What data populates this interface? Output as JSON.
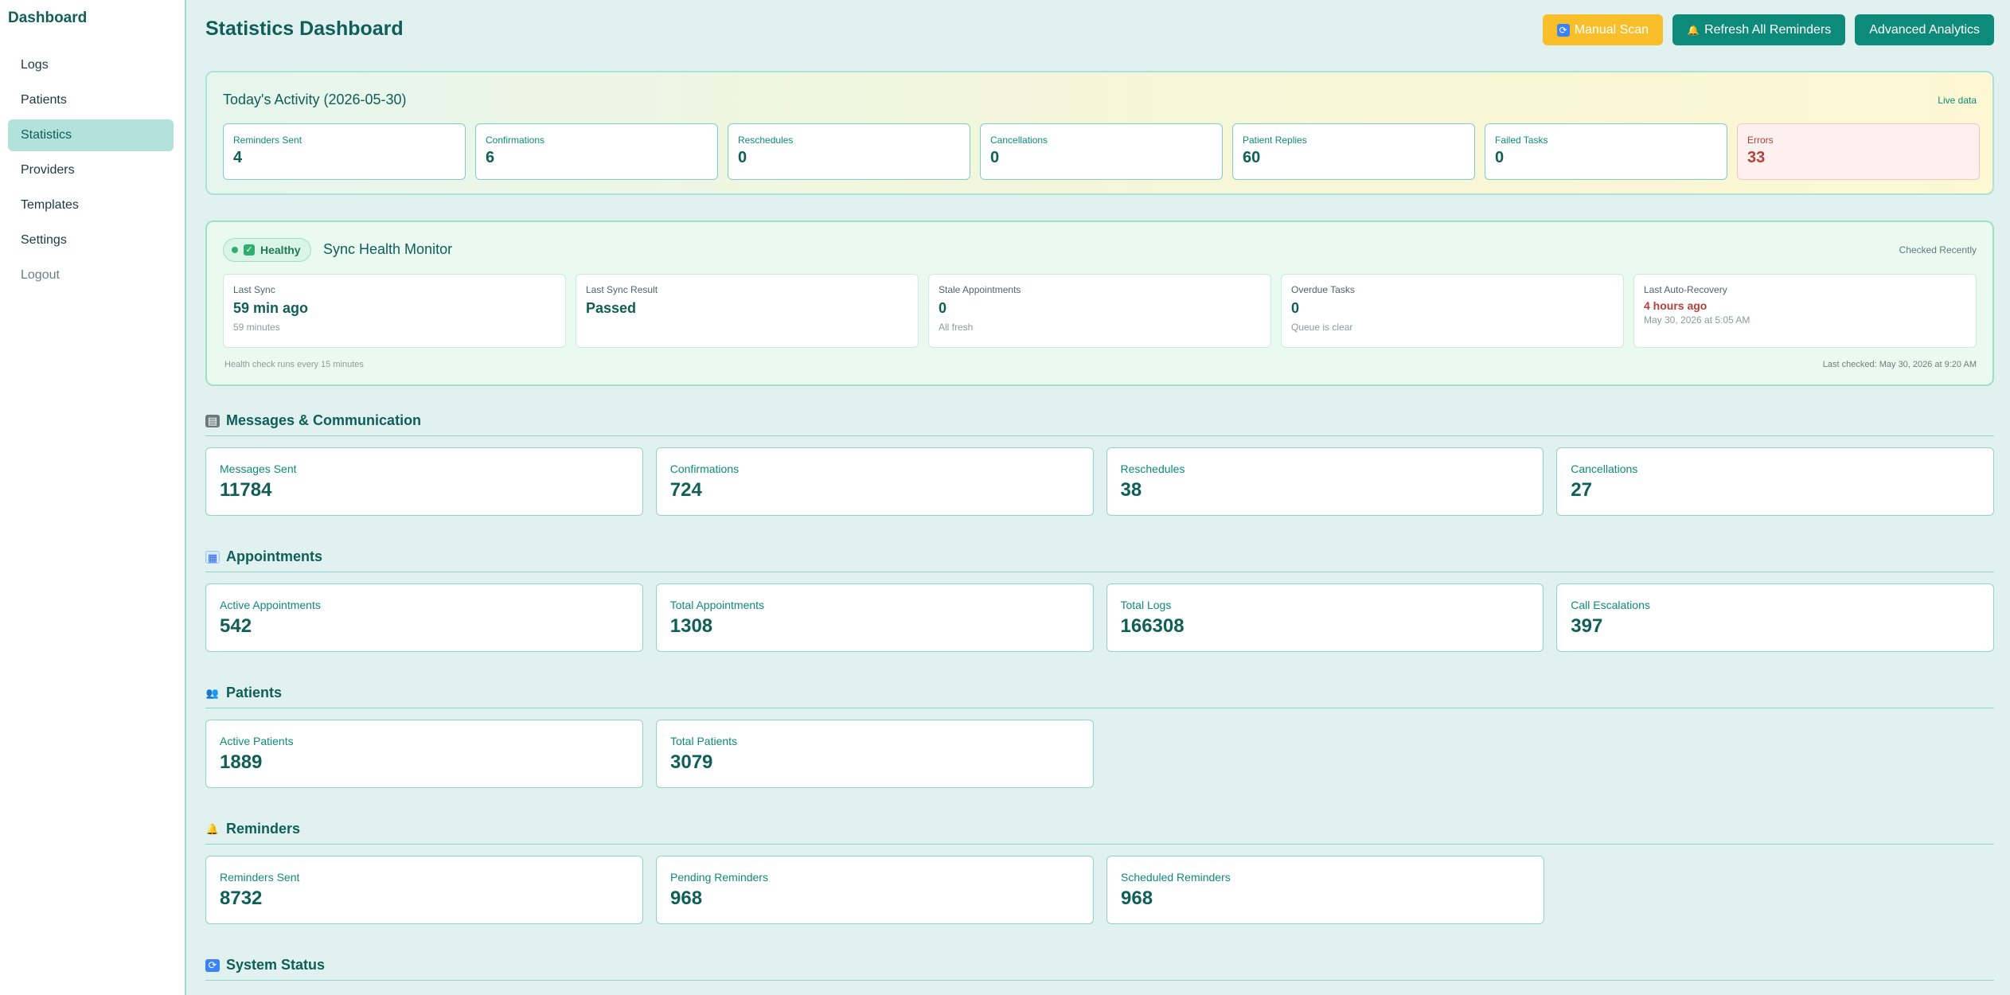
{
  "sidebar": {
    "brand": "Dashboard",
    "items": [
      {
        "label": "Logs"
      },
      {
        "label": "Patients"
      },
      {
        "label": "Statistics"
      },
      {
        "label": "Providers"
      },
      {
        "label": "Templates"
      },
      {
        "label": "Settings"
      },
      {
        "label": "Logout"
      }
    ]
  },
  "header": {
    "title": "Statistics Dashboard",
    "buttons": {
      "manual_scan": "Manual Scan",
      "refresh": "Refresh All Reminders",
      "analytics": "Advanced Analytics"
    }
  },
  "today": {
    "title": "Today's Activity (2026-05-30)",
    "live": "Live data",
    "cards": [
      {
        "label": "Reminders Sent",
        "value": "4"
      },
      {
        "label": "Confirmations",
        "value": "6"
      },
      {
        "label": "Reschedules",
        "value": "0"
      },
      {
        "label": "Cancellations",
        "value": "0"
      },
      {
        "label": "Patient Replies",
        "value": "60"
      },
      {
        "label": "Failed Tasks",
        "value": "0"
      },
      {
        "label": "Errors",
        "value": "33"
      }
    ]
  },
  "health": {
    "badge": "Healthy",
    "title": "Sync Health Monitor",
    "status": "Checked Recently",
    "cards": [
      {
        "label": "Last Sync",
        "value": "59 min ago",
        "sub": "59 minutes"
      },
      {
        "label": "Last Sync Result",
        "value": "Passed",
        "sub": ""
      },
      {
        "label": "Stale Appointments",
        "value": "0",
        "sub": "All fresh"
      },
      {
        "label": "Overdue Tasks",
        "value": "0",
        "sub": "Queue is clear"
      },
      {
        "label": "Last Auto-Recovery",
        "value": "4 hours ago",
        "sub": "May 30, 2026 at 5:05 AM"
      }
    ],
    "footer_left": "Health check runs every 15 minutes",
    "footer_right": "Last checked: May 30, 2026 at 9:20 AM"
  },
  "sections": {
    "messages": {
      "title": "Messages & Communication",
      "icon": "message-icon",
      "cards": [
        {
          "label": "Messages Sent",
          "value": "11784"
        },
        {
          "label": "Confirmations",
          "value": "724"
        },
        {
          "label": "Reschedules",
          "value": "38"
        },
        {
          "label": "Cancellations",
          "value": "27"
        }
      ]
    },
    "appointments": {
      "title": "Appointments",
      "icon": "calendar-icon",
      "cards": [
        {
          "label": "Active Appointments",
          "value": "542"
        },
        {
          "label": "Total Appointments",
          "value": "1308"
        },
        {
          "label": "Total Logs",
          "value": "166308"
        },
        {
          "label": "Call Escalations",
          "value": "397"
        }
      ]
    },
    "patients": {
      "title": "Patients",
      "icon": "people-icon",
      "cards": [
        {
          "label": "Active Patients",
          "value": "1889"
        },
        {
          "label": "Total Patients",
          "value": "3079"
        }
      ]
    },
    "reminders": {
      "title": "Reminders",
      "icon": "bell-icon",
      "cards": [
        {
          "label": "Reminders Sent",
          "value": "8732"
        },
        {
          "label": "Pending Reminders",
          "value": "968"
        },
        {
          "label": "Scheduled Reminders",
          "value": "968"
        }
      ]
    },
    "system": {
      "title": "System Status",
      "icon": "refresh-icon"
    }
  },
  "colors": {
    "accent": "#0e8a7a",
    "warning_button": "#f9bf2b",
    "error": "#b3413a",
    "healthy": "#2fae72",
    "background": "#e0f1f0"
  }
}
